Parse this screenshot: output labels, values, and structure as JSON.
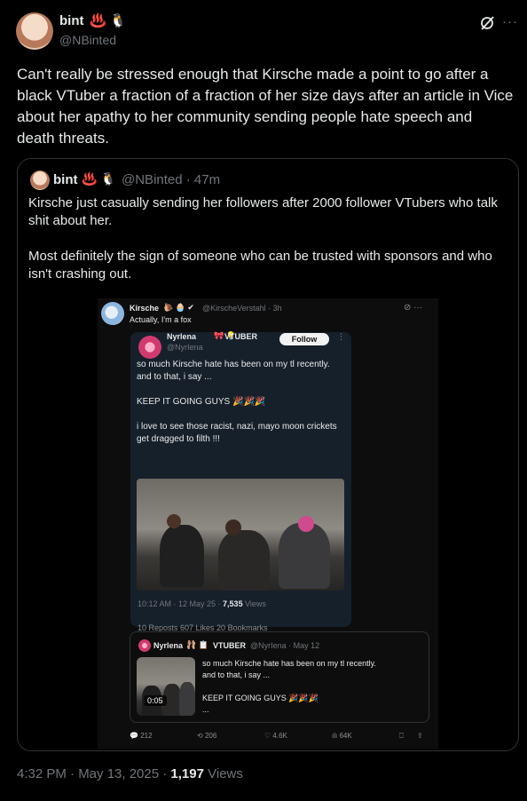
{
  "tweet": {
    "author_name": "bint",
    "author_emoji": "♨️ 🐧",
    "author_handle": "@NBinted",
    "text": "Can't really be stressed enough that Kirsche made a point to go after a black VTuber a fraction of a fraction of her size days after an article in Vice about her apathy to her community sending people hate speech and death threats.",
    "more_icon": "···",
    "timestamp": "4:32 PM · May 13, 2025 · ",
    "views_count": "1,197",
    "views_label": " Views"
  },
  "quote": {
    "author_name": "bint",
    "author_emoji": "♨️ 🐧",
    "handle_time": "@NBinted · 47m",
    "text": "Kirsche just casually sending her followers after 2000 follower VTubers who talk shit about her.\n\nMost definitely the sign of someone who can be trusted with sponsors and who isn't crashing out."
  },
  "screenshot": {
    "kirsche_name": "Kirsche",
    "kirsche_emoji": "🐌 🧁 ✔",
    "kirsche_handle": "@KirscheVerstahl · 3h",
    "kirsche_text": "Actually, I'm a fox",
    "kirsche_icons": "⊘ ···",
    "nyrlena_name": "Nyrlena",
    "nyrlena_badge": "🎀 💡",
    "nyrlena_vtuber": "VTUBER",
    "nyrlena_handle": "@NyrIena",
    "follow_label": "Follow",
    "nyrlena_more": "⋮",
    "nyrlena_text": "so much Kirsche hate has been on my tl recently.\nand to that, i say ...\n\nKEEP IT GOING GUYS 🎉🎉🎉\n\ni love to see those racist, nazi, mayo moon crickets get dragged to filth !!!",
    "meta_time": "10:12 AM · 12 May 25 · ",
    "meta_views_count": "7,535",
    "meta_views_label": " Views",
    "engage_text": "10 Reposts  607 Likes  20 Bookmarks",
    "mini_name": "Nyrlena",
    "mini_emoji": "🩰 📋",
    "mini_vtuber": "VTUBER",
    "mini_handle": "@NyrIena · May 12",
    "mini_duration": "0:05",
    "mini_text": "so much Kirsche hate has been on my tl recently.\nand to that, i say ...\n\nKEEP IT GOING GUYS 🎉🎉🎉\n...",
    "actions": {
      "replies": "212",
      "reposts": "206",
      "likes": "4.6K",
      "views": "64K"
    }
  },
  "icons": [
    "grok-icon",
    "more-icon",
    "reply-icon",
    "repost-icon",
    "like-icon",
    "views-icon",
    "bookmark-icon",
    "share-icon"
  ]
}
